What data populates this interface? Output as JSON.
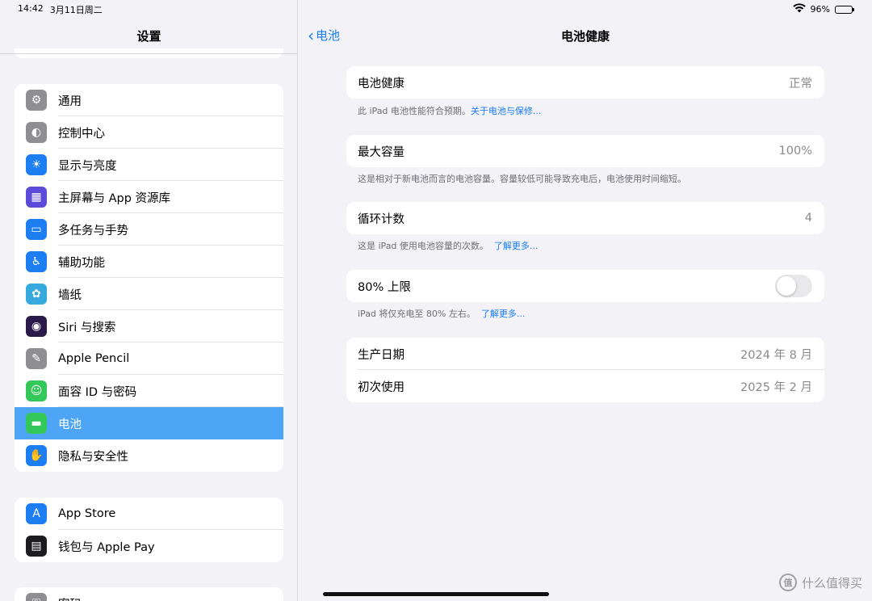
{
  "status": {
    "time": "14:42",
    "date": "3月11日周二",
    "battery": "96%"
  },
  "sidebar": {
    "title": "设置",
    "group1": [
      {
        "label": "通用",
        "icon": "gear-icon",
        "color": "#8e8e93",
        "glyph": "⚙"
      },
      {
        "label": "控制中心",
        "icon": "toggles-icon",
        "color": "#8e8e93",
        "glyph": "◐"
      },
      {
        "label": "显示与亮度",
        "icon": "sun-icon",
        "color": "#1c7ef0",
        "glyph": "☀"
      },
      {
        "label": "主屏幕与 App 资源库",
        "icon": "home-grid-icon",
        "color": "#5b4bd8",
        "glyph": "▦"
      },
      {
        "label": "多任务与手势",
        "icon": "multitask-icon",
        "color": "#1c7ef0",
        "glyph": "▭"
      },
      {
        "label": "辅助功能",
        "icon": "accessibility-icon",
        "color": "#1c7ef0",
        "glyph": "♿"
      },
      {
        "label": "墙纸",
        "icon": "flower-icon",
        "color": "#36aadc",
        "glyph": "✿"
      },
      {
        "label": "Siri 与搜索",
        "icon": "siri-icon",
        "color": "#2a1a4a",
        "glyph": "◉"
      },
      {
        "label": "Apple Pencil",
        "icon": "pencil-icon",
        "color": "#8e8e93",
        "glyph": "✎"
      },
      {
        "label": "面容 ID 与密码",
        "icon": "faceid-icon",
        "color": "#34c759",
        "glyph": "☺"
      },
      {
        "label": "电池",
        "icon": "battery-icon",
        "color": "#34c759",
        "glyph": "▬",
        "selected": true
      },
      {
        "label": "隐私与安全性",
        "icon": "hand-icon",
        "color": "#1c7ef0",
        "glyph": "✋"
      }
    ],
    "group2": [
      {
        "label": "App Store",
        "icon": "appstore-icon",
        "color": "#1c7ef0",
        "glyph": "A"
      },
      {
        "label": "钱包与 Apple Pay",
        "icon": "wallet-icon",
        "color": "#1c1c1e",
        "glyph": "▤"
      }
    ],
    "group3": [
      {
        "label": "密码",
        "icon": "key-icon",
        "color": "#8e8e93",
        "glyph": "⚿"
      }
    ]
  },
  "main": {
    "back_label": "电池",
    "title": "电池健康",
    "health": {
      "label": "电池健康",
      "value": "正常",
      "footer_text": "此 iPad 电池性能符合预期。",
      "footer_link": "关于电池与保修..."
    },
    "capacity": {
      "label": "最大容量",
      "value": "100%",
      "footer_text": "这是相对于新电池而言的电池容量。容量较低可能导致充电后，电池使用时间缩短。"
    },
    "cycles": {
      "label": "循环计数",
      "value": "4",
      "footer_text": "这是 iPad 使用电池容量的次数。",
      "footer_link": "了解更多..."
    },
    "limit": {
      "label": "80% 上限",
      "on": false,
      "footer_text": "iPad 将仅充电至 80% 左右。",
      "footer_link": "了解更多..."
    },
    "dates": {
      "manufacture_label": "生产日期",
      "manufacture_value": "2024 年 8 月",
      "first_use_label": "初次使用",
      "first_use_value": "2025 年 2 月"
    }
  },
  "watermark": {
    "text": "什么值得买",
    "glyph": "值"
  }
}
